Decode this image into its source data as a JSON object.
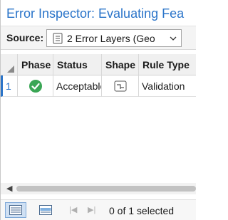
{
  "header": {
    "title": "Error Inspector: Evaluating Fea"
  },
  "source": {
    "label": "Source:",
    "value": "2 Error Layers (Geo",
    "icon": "layers-list-icon"
  },
  "grid": {
    "columns": [
      "Phase",
      "Status",
      "Shape",
      "Rule Type"
    ],
    "rows": [
      {
        "row_number": "1",
        "phase_icon": "check-circle-icon",
        "status": "Acceptable",
        "shape_icon": "polyline-icon",
        "rule_type": "Validation"
      }
    ]
  },
  "footer": {
    "selection_text": "0 of 1 selected"
  },
  "colors": {
    "accent": "#2a74c9",
    "phase_ok": "#3aa655"
  }
}
